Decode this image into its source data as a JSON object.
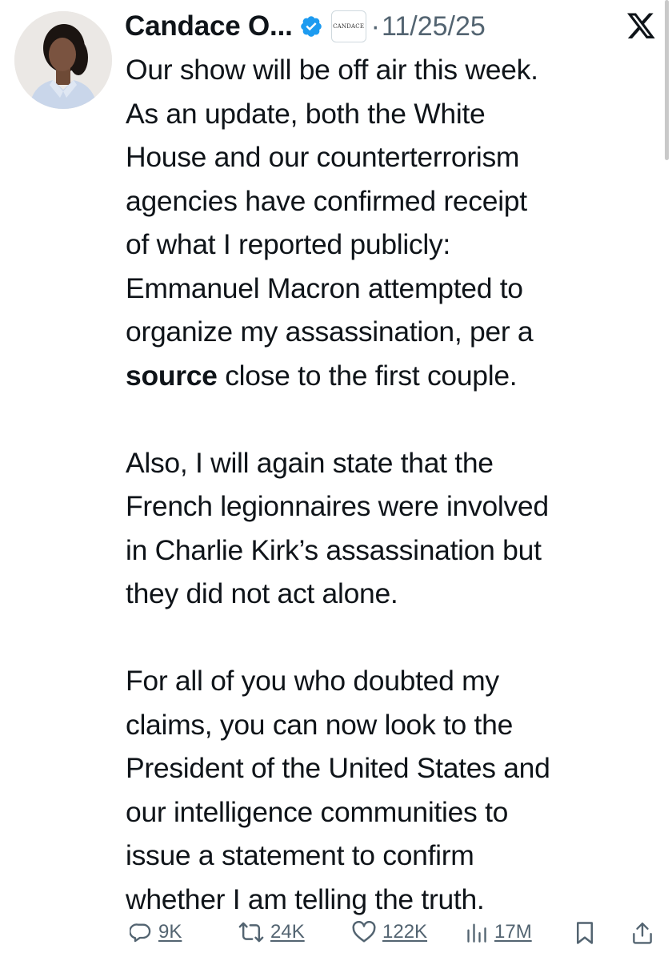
{
  "author": {
    "display_name": "Candace O...",
    "affiliate_badge_text": "CANDACE",
    "separator": "·",
    "timestamp": "11/25/25",
    "verified_color": "#1d9bf0"
  },
  "tweet": {
    "paragraph1_lines": [
      "Our show will be off air this week.",
      "As an update, both the White",
      "House and our counterterrorism",
      "agencies have confirmed receipt",
      "of what I reported publicly:",
      "Emmanuel Macron attempted to",
      "organize my assassination, per a"
    ],
    "paragraph1_link": "source",
    "paragraph1_tail": " close to the first couple.",
    "paragraph2_lines": [
      "Also, I will again state that the",
      "French legionnaires were involved",
      "in Charlie Kirk’s assassination but",
      "they did not act alone."
    ],
    "paragraph3_lines": [
      "For all of you who doubted my",
      "claims, you can now look to the",
      "President of the United States and",
      "our intelligence communities to",
      "issue a statement to confirm",
      "whether I am telling the truth."
    ]
  },
  "actions": {
    "replies": "9K",
    "reposts": "24K",
    "likes": "122K",
    "views": "17M"
  },
  "icons": {
    "logo": "x-logo-icon",
    "verified": "verified-badge-icon",
    "reply": "reply-icon",
    "repost": "repost-icon",
    "like": "heart-icon",
    "views": "views-icon",
    "bookmark": "bookmark-icon",
    "share": "share-icon"
  }
}
